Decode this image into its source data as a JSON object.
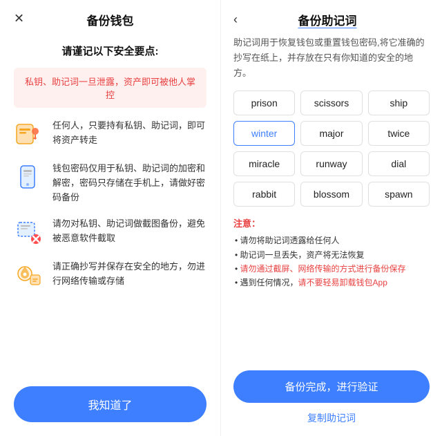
{
  "left": {
    "close_icon": "✕",
    "title": "备份钱包",
    "subtitle": "请谨记以下安全要点:",
    "warning": "私钥、助记词一旦泄露，资产即可被他人掌控",
    "items": [
      {
        "id": "key",
        "text": "任何人，只要持有私钥、助记词，即可将资产转走"
      },
      {
        "id": "phone",
        "text": "钱包密码仅用于私钥、助记词的加密和解密，密码只存储在手机上，请做好密码备份"
      },
      {
        "id": "screenshot",
        "text": "请勿对私钥、助记词做截图备份，避免被恶意软件截取"
      },
      {
        "id": "location",
        "text": "请正确抄写并保存在安全的地方，勿进行网络传输或存储"
      }
    ],
    "know_btn": "我知道了"
  },
  "right": {
    "back_icon": "‹",
    "title": "备份助记词",
    "desc": "助记词用于恢复钱包或重置钱包密码,将它准确的抄写在纸上，并存放在只有你知道的安全的地方。",
    "words": [
      {
        "word": "prison",
        "highlighted": false
      },
      {
        "word": "scissors",
        "highlighted": false
      },
      {
        "word": "ship",
        "highlighted": false
      },
      {
        "word": "winter",
        "highlighted": true
      },
      {
        "word": "major",
        "highlighted": false
      },
      {
        "word": "twice",
        "highlighted": false
      },
      {
        "word": "miracle",
        "highlighted": false
      },
      {
        "word": "runway",
        "highlighted": false
      },
      {
        "word": "dial",
        "highlighted": false
      },
      {
        "word": "rabbit",
        "highlighted": false
      },
      {
        "word": "blossom",
        "highlighted": false
      },
      {
        "word": "spawn",
        "highlighted": false
      }
    ],
    "notes_title": "注意：",
    "notes": [
      "• 请勿将助记词透露给任何人",
      "• 助记词一旦丢失，资产将无法恢复",
      "• 请勿通过截屏、网络传输的方式进行备份保存",
      "• 遇到任何情况，请不要轻易卸载钱包App"
    ],
    "notes_highlights": [
      false,
      false,
      true,
      true
    ],
    "verify_btn": "备份完成，进行验证",
    "copy_link": "复制助记词"
  }
}
